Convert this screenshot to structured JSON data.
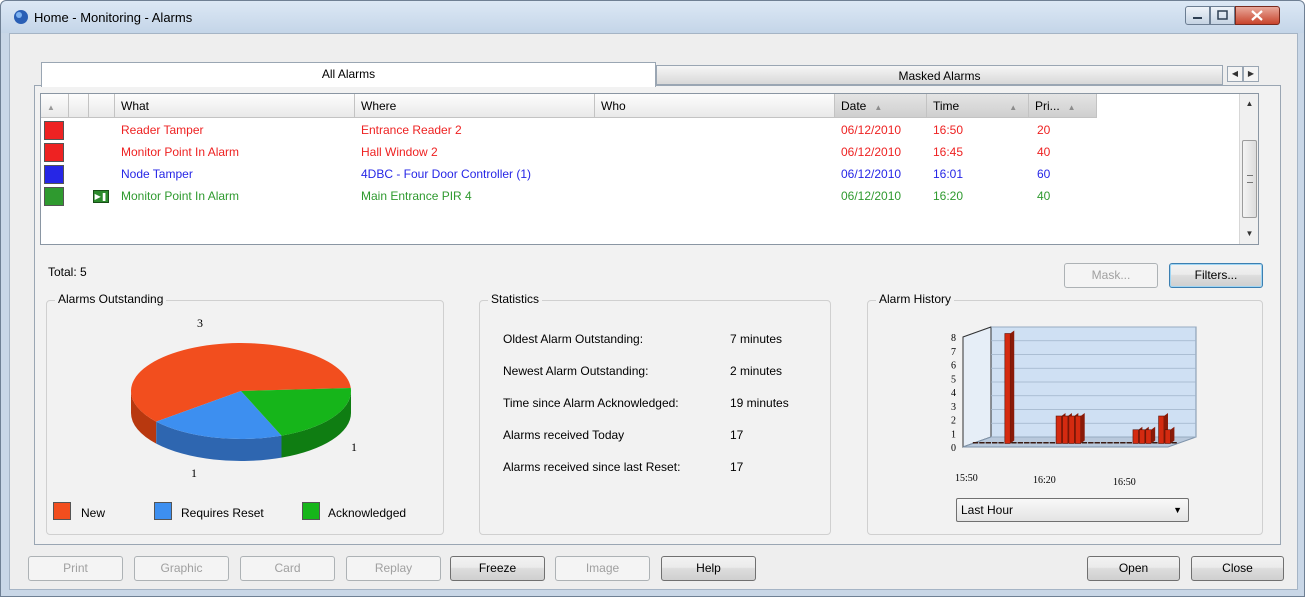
{
  "window": {
    "title": "Home - Monitoring - Alarms"
  },
  "tabs": [
    {
      "label": "All Alarms"
    },
    {
      "label": "Masked Alarms"
    }
  ],
  "grid": {
    "columns": [
      "What",
      "Where",
      "Who",
      "Date",
      "Time",
      "Pri..."
    ],
    "rows": [
      {
        "what": "Reader Tamper",
        "where": "Entrance Reader 2",
        "who": "",
        "date": "06/12/2010",
        "time": "16:50",
        "priority": "20",
        "color": "#ee2222",
        "state": "new"
      },
      {
        "what": "Monitor Point In Alarm",
        "where": "Hall Window 2",
        "who": "",
        "date": "06/12/2010",
        "time": "16:45",
        "priority": "40",
        "color": "#ee2222",
        "state": "new"
      },
      {
        "what": "Node Tamper",
        "where": "4DBC - Four Door Controller (1)",
        "who": "",
        "date": "06/12/2010",
        "time": "16:01",
        "priority": "60",
        "color": "#2626e6",
        "state": "requires-reset"
      },
      {
        "what": "Monitor Point In Alarm",
        "where": "Main Entrance PIR 4",
        "who": "",
        "date": "06/12/2010",
        "time": "16:20",
        "priority": "40",
        "color": "#2f9a2f",
        "state": "acknowledged"
      }
    ]
  },
  "total": "Total: 5",
  "buttons": {
    "mask": "Mask...",
    "filters": "Filters..."
  },
  "alarms_outstanding": {
    "title": "Alarms Outstanding",
    "chart_data": {
      "type": "pie",
      "categories": [
        "New",
        "Requires Reset",
        "Acknowledged"
      ],
      "values": [
        3,
        1,
        1
      ],
      "colors": [
        "#f24e1e",
        "#3d8ff0",
        "#16b51a"
      ],
      "labels": [
        "3",
        "1",
        "1"
      ]
    },
    "legend": [
      "New",
      "Requires Reset",
      "Acknowledged"
    ]
  },
  "statistics": {
    "title": "Statistics",
    "items": [
      {
        "label": "Oldest Alarm Outstanding:",
        "value": "7 minutes"
      },
      {
        "label": "Newest Alarm Outstanding:",
        "value": "2 minutes"
      },
      {
        "label": "Time since Alarm Acknowledged:",
        "value": "19 minutes"
      },
      {
        "label": "Alarms received Today",
        "value": "17"
      },
      {
        "label": "Alarms received since last Reset:",
        "value": "17"
      }
    ]
  },
  "alarm_history": {
    "title": "Alarm History",
    "chart_data": {
      "type": "bar",
      "y_ticks": [
        "0",
        "1",
        "2",
        "3",
        "4",
        "5",
        "6",
        "7",
        "8"
      ],
      "x_ticks": [
        "15:50",
        "16:20",
        "16:50"
      ],
      "ylim": [
        0,
        8
      ],
      "values": [
        0,
        0,
        0,
        0,
        0,
        8,
        0,
        0,
        0,
        0,
        0,
        0,
        0,
        2,
        2,
        2,
        2,
        0,
        0,
        0,
        0,
        0,
        0,
        0,
        0,
        1,
        1,
        1,
        0,
        2,
        1,
        0
      ],
      "color": "#d42a10"
    },
    "range": "Last Hour"
  },
  "bottom_buttons": {
    "print": "Print",
    "graphic": "Graphic",
    "card": "Card",
    "replay": "Replay",
    "freeze": "Freeze",
    "image": "Image",
    "help": "Help",
    "open": "Open",
    "close": "Close"
  }
}
